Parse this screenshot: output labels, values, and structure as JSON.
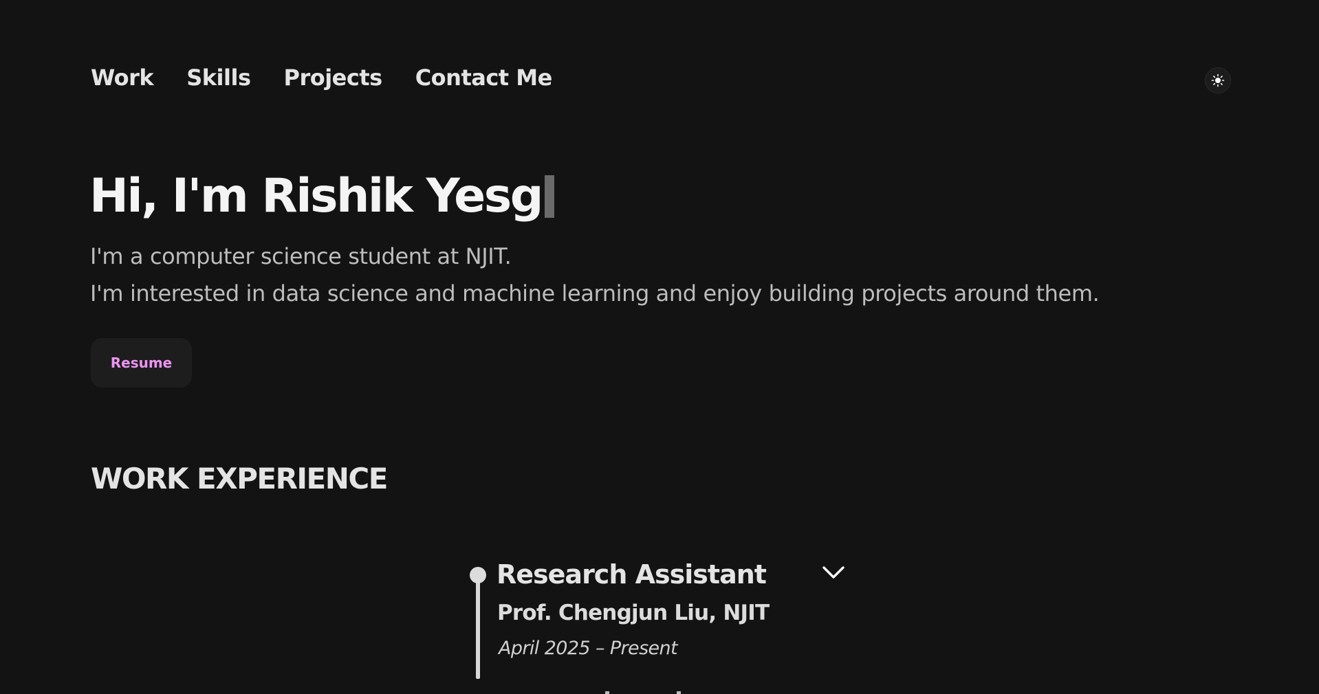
{
  "nav": {
    "items": [
      {
        "label": "Work"
      },
      {
        "label": "Skills"
      },
      {
        "label": "Projects"
      },
      {
        "label": "Contact Me"
      }
    ],
    "theme_toggle_icon": "sun-icon"
  },
  "hero": {
    "title": "Hi, I'm Rishik Yesg",
    "line1": "I'm a computer science student at NJIT.",
    "line2": "I'm interested in data science and machine learning and enjoy building projects around them.",
    "resume_label": "Resume"
  },
  "work": {
    "heading": "WORK EXPERIENCE",
    "items": [
      {
        "title": "Research Assistant",
        "org": "Prof. Chengjun Liu, NJIT",
        "dates": "April 2025 – Present",
        "expand_icon": "chevron-down-icon"
      }
    ]
  },
  "colors": {
    "background": "#131313",
    "accent": "#ec94f2",
    "text": "#e4e4e4",
    "muted_text": "#bdbdbd"
  }
}
